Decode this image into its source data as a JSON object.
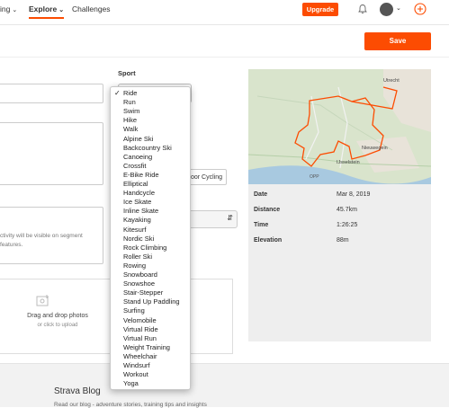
{
  "nav": {
    "training_partial": "ing",
    "explore": "Explore",
    "challenges": "Challenges",
    "upgrade": "Upgrade"
  },
  "actions": {
    "save": "Save"
  },
  "form": {
    "sport_label": "Sport",
    "indoor_partial": "oor Cycling",
    "privacy_line1": "ctivity will be visible on segment",
    "privacy_line2": "features."
  },
  "upload": {
    "title": "Drag and drop photos",
    "subtitle": "or click to upload"
  },
  "map": {
    "labels": [
      "Utrecht",
      "Nieuwegein",
      "IJsselstein",
      "OPP"
    ],
    "colors": {
      "route": "#fc4c02",
      "land": "#d9e4cc",
      "water": "#a8c9e0",
      "urban": "#e8e3d9"
    }
  },
  "stats": [
    {
      "label": "Date",
      "value": "Mar 8, 2019"
    },
    {
      "label": "Distance",
      "value": "45.7km"
    },
    {
      "label": "Time",
      "value": "1:26:25"
    },
    {
      "label": "Elevation",
      "value": "88m"
    }
  ],
  "footer": {
    "blog_title": "Strava Blog",
    "blog_sub": "Read our blog - adventure stories, training tips and insights"
  },
  "sport_dropdown": {
    "selected": "Ride",
    "options": [
      "Ride",
      "Run",
      "Swim",
      "Hike",
      "Walk",
      "Alpine Ski",
      "Backcountry Ski",
      "Canoeing",
      "Crossfit",
      "E-Bike Ride",
      "Elliptical",
      "Handcycle",
      "Ice Skate",
      "Inline Skate",
      "Kayaking",
      "Kitesurf",
      "Nordic Ski",
      "Rock Climbing",
      "Roller Ski",
      "Rowing",
      "Snowboard",
      "Snowshoe",
      "Stair-Stepper",
      "Stand Up Paddling",
      "Surfing",
      "Velomobile",
      "Virtual Ride",
      "Virtual Run",
      "Weight Training",
      "Wheelchair",
      "Windsurf",
      "Workout",
      "Yoga"
    ]
  },
  "theme": {
    "accent": "#fc4c02"
  }
}
